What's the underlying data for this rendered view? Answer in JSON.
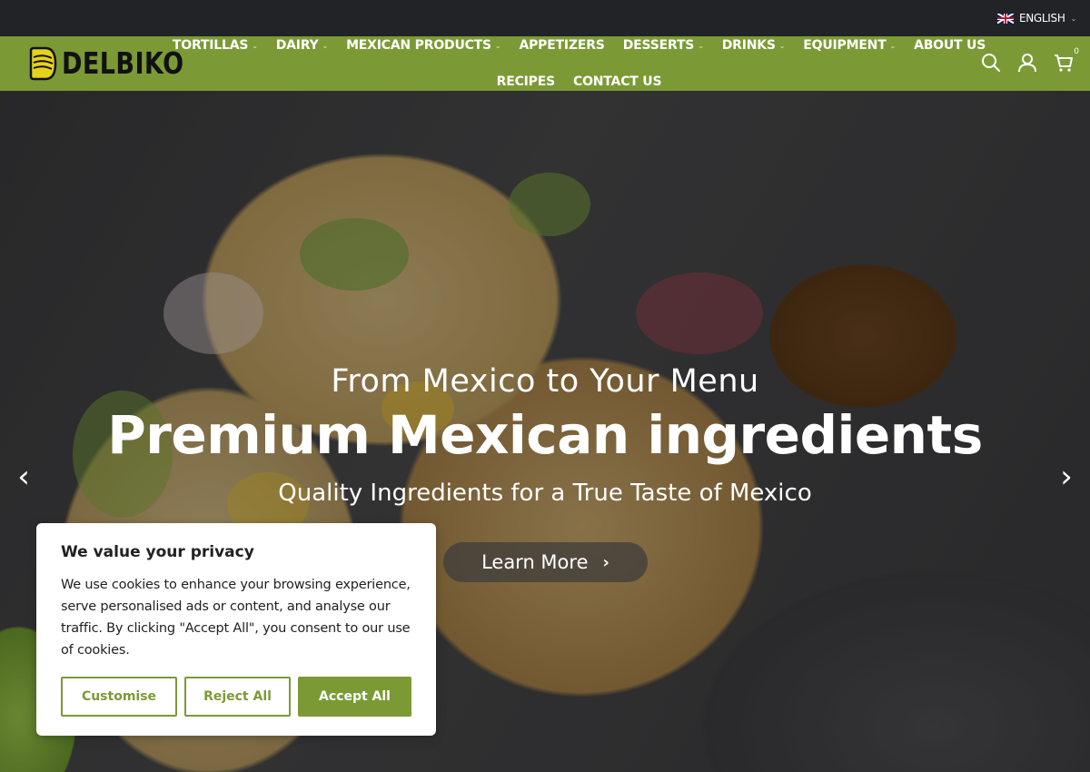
{
  "topbar": {
    "language": "ENGLISH"
  },
  "brand": {
    "logo_text": "DELBIKO",
    "accent_color": "#7b9a35"
  },
  "nav": {
    "row1": [
      {
        "label": "TORTILLAS",
        "has_dropdown": true
      },
      {
        "label": "DAIRY",
        "has_dropdown": true
      },
      {
        "label": "MEXICAN PRODUCTS",
        "has_dropdown": true
      },
      {
        "label": "APPETIZERS",
        "has_dropdown": false
      },
      {
        "label": "DESSERTS",
        "has_dropdown": true
      },
      {
        "label": "DRINKS",
        "has_dropdown": true
      },
      {
        "label": "EQUIPMENT",
        "has_dropdown": true
      },
      {
        "label": "ABOUT US",
        "has_dropdown": false
      }
    ],
    "row2": [
      {
        "label": "RECIPES",
        "has_dropdown": false
      },
      {
        "label": "CONTACT US",
        "has_dropdown": false
      }
    ]
  },
  "header_icons": {
    "search": "search-icon",
    "account": "user-icon",
    "cart": "cart-icon",
    "cart_count": "0"
  },
  "hero": {
    "kicker": "From Mexico to Your Menu",
    "headline": "Premium Mexican ingredients",
    "subline": "Quality Ingredients for a True Taste of Mexico",
    "cta_label": "Learn More"
  },
  "cookie": {
    "title": "We value your privacy",
    "body": "We use cookies to enhance your browsing experience, serve personalised ads or content, and analyse our traffic. By clicking \"Accept All\", you consent to our use of cookies.",
    "customise_label": "Customise",
    "reject_label": "Reject All",
    "accept_label": "Accept All"
  }
}
